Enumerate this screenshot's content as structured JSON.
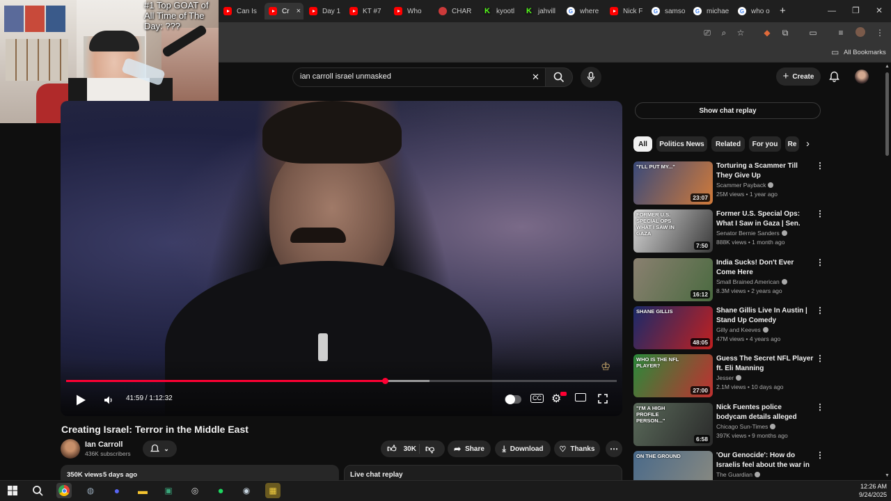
{
  "browser": {
    "tabs": [
      {
        "label": "Can Is",
        "icon": "youtube-icon"
      },
      {
        "label": "Cr",
        "icon": "youtube-icon",
        "active": true
      },
      {
        "label": "Day 1",
        "icon": "youtube-icon"
      },
      {
        "label": "KT #7",
        "icon": "youtube-icon"
      },
      {
        "label": "Who",
        "icon": "youtube-icon"
      },
      {
        "label": "CHAR",
        "icon": "site-icon"
      },
      {
        "label": "kyootl",
        "icon": "kick-icon"
      },
      {
        "label": "jahvill",
        "icon": "kick-icon"
      },
      {
        "label": "where",
        "icon": "google-icon"
      },
      {
        "label": "Nick F",
        "icon": "youtube-icon"
      },
      {
        "label": "samso",
        "icon": "google-icon"
      },
      {
        "label": "michae",
        "icon": "google-icon"
      },
      {
        "label": "who o",
        "icon": "google-icon"
      }
    ],
    "tab_close": "×",
    "new_tab": "+",
    "bookmarks_label": "All Bookmarks"
  },
  "webcam": {
    "overlay_text": "#1 Top GOAT of All Time of The Day: ???"
  },
  "youtube": {
    "search_query": "ian carroll israel unmasked",
    "clear_symbol": "✕",
    "create_label": "Create",
    "video": {
      "time_current": "41:59",
      "time_separator": " / ",
      "time_total": "1:12:32",
      "progress": 0.58,
      "buffered": 0.66,
      "title": "Creating Israel: Terror in the Middle East",
      "channel": "Ian Carroll",
      "subscribers": "436K subscribers",
      "likes": "30K",
      "share_label": "Share",
      "download_label": "Download",
      "thanks_label": "Thanks",
      "views": "350K views",
      "age": "5 days ago",
      "live_chat_label": "Live chat replay"
    },
    "sidebar": {
      "chat_replay_label": "Show chat replay",
      "chips": [
        "All",
        "Politics News",
        "Related",
        "For you",
        "Re"
      ],
      "recommendations": [
        {
          "title": "Torturing a Scammer Till They Give Up",
          "channel": "Scammer Payback",
          "meta": "25M views • 1 year ago",
          "duration": "23:07",
          "thumb_text": "\"I'LL PUT MY...\"",
          "c1": "#3a4a7a",
          "c2": "#d07a3a"
        },
        {
          "title": "Former U.S. Special Ops: What I Saw in Gaza | Sen. Bernie ...",
          "channel": "Senator Bernie Sanders",
          "meta": "888K views • 1 month ago",
          "duration": "7:50",
          "thumb_text": "FORMER U.S. SPECIAL OPS WHAT I SAW IN GAZA",
          "c1": "#d8d8d8",
          "c2": "#3a3a3a"
        },
        {
          "title": "India Sucks! Don't Ever Come Here",
          "channel": "Small Brained American",
          "meta": "8.3M views • 2 years ago",
          "duration": "16:12",
          "thumb_text": "",
          "c1": "#8a8070",
          "c2": "#4a6a40"
        },
        {
          "title": "Shane Gillis Live In Austin | Stand Up Comedy",
          "channel": "Gilly and Keeves",
          "meta": "47M views • 4 years ago",
          "duration": "48:05",
          "thumb_text": "SHANE GILLIS",
          "c1": "#1a2a6a",
          "c2": "#c02020"
        },
        {
          "title": "Guess The Secret NFL Player ft. Eli Manning",
          "channel": "Jesser",
          "meta": "2.1M views • 10 days ago",
          "duration": "27:00",
          "thumb_text": "WHO IS THE NFL PLAYER?",
          "c1": "#2a8a3a",
          "c2": "#c03030"
        },
        {
          "title": "Nick Fuentes police bodycam details alleged Berwyn pepper ...",
          "channel": "Chicago Sun-Times",
          "meta": "397K views • 9 months ago",
          "duration": "6:58",
          "thumb_text": "\"I'M A HIGH PROFILE PERSON...\"",
          "c1": "#5a6a5a",
          "c2": "#2a2a2a"
        },
        {
          "title": "'Our Genocide': How do Israelis feel about the war in Gaza? | O...",
          "channel": "The Guardian",
          "meta": "",
          "duration": "",
          "thumb_text": "ON THE GROUND",
          "c1": "#4a6a8a",
          "c2": "#8a8a80"
        }
      ]
    }
  },
  "taskbar": {
    "time": "12:26 AM",
    "date": "9/24/2025"
  },
  "colors": {
    "accent_red": "#ff0033",
    "background": "#0f0f0f",
    "surface": "#272727"
  }
}
